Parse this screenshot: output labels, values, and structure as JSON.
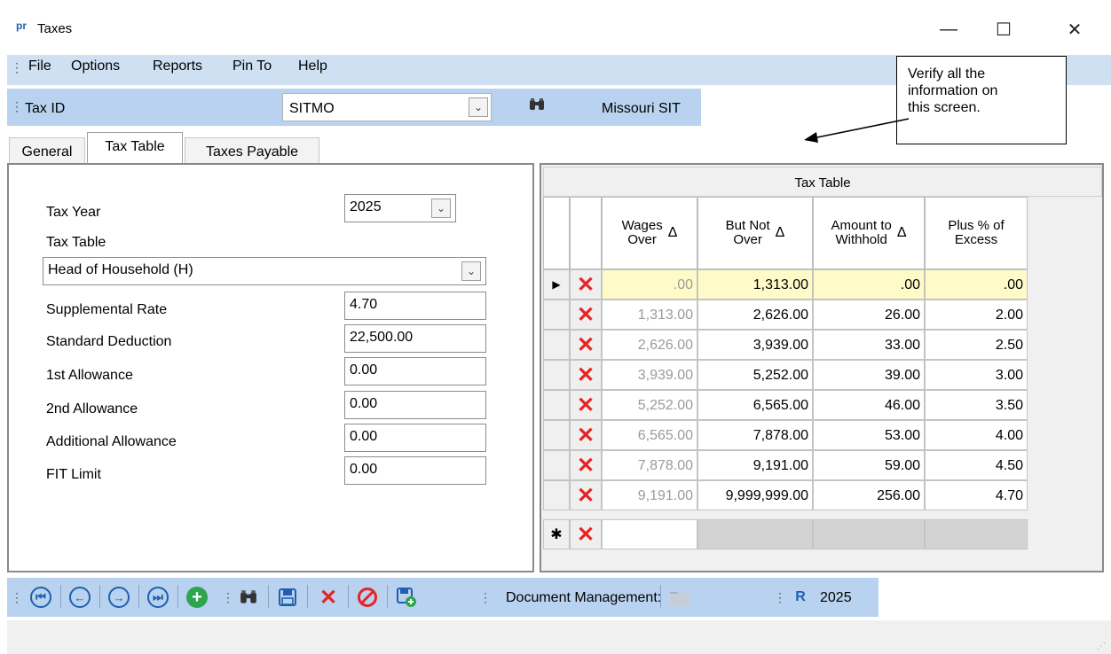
{
  "window": {
    "logo": "pr",
    "title": "Taxes",
    "minimize": "—",
    "maximize": "☐",
    "close": "✕"
  },
  "menu": [
    "File",
    "Options",
    "Reports",
    "Pin To",
    "Help"
  ],
  "taxbar": {
    "label": "Tax ID",
    "value": "SITMO",
    "name": "Missouri SIT"
  },
  "tabs": [
    "General",
    "Tax Table",
    "Taxes Payable"
  ],
  "form": {
    "tax_year_label": "Tax Year",
    "tax_year": "2025",
    "tax_table_label": "Tax Table",
    "tax_table": "Head of Household (H)",
    "fields": [
      {
        "label": "Supplemental Rate",
        "value": "4.70"
      },
      {
        "label": "Standard Deduction",
        "value": "22,500.00"
      },
      {
        "label": "1st Allowance",
        "value": "0.00"
      },
      {
        "label": "2nd Allowance",
        "value": "0.00"
      },
      {
        "label": "Additional Allowance",
        "value": "0.00"
      },
      {
        "label": "FIT Limit",
        "value": "0.00"
      }
    ]
  },
  "grid": {
    "title": "Tax Table",
    "columns": [
      {
        "line1": "Wages",
        "line2": "Over",
        "sort": "Δ"
      },
      {
        "line1": "But Not",
        "line2": "Over",
        "sort": "Δ"
      },
      {
        "line1": "Amount to",
        "line2": "Withhold",
        "sort": "Δ"
      },
      {
        "line1": "Plus % of",
        "line2": "Excess",
        "sort": ""
      }
    ],
    "rows": [
      [
        ".00",
        "1,313.00",
        ".00",
        ".00"
      ],
      [
        "1,313.00",
        "2,626.00",
        "26.00",
        "2.00"
      ],
      [
        "2,626.00",
        "3,939.00",
        "33.00",
        "2.50"
      ],
      [
        "3,939.00",
        "5,252.00",
        "39.00",
        "3.00"
      ],
      [
        "5,252.00",
        "6,565.00",
        "46.00",
        "3.50"
      ],
      [
        "6,565.00",
        "7,878.00",
        "53.00",
        "4.00"
      ],
      [
        "7,878.00",
        "9,191.00",
        "59.00",
        "4.50"
      ],
      [
        "9,191.00",
        "9,999,999.00",
        "256.00",
        "4.70"
      ]
    ],
    "current_row_marker": "▶",
    "new_row_marker": "✱"
  },
  "callout": {
    "line1": "Verify all the",
    "line2": "information on",
    "line3": "this screen."
  },
  "toolbar": {
    "doc_label": "Document Management:",
    "year": "2025"
  },
  "colors": {
    "toolbar": "#b8d2ef",
    "menubar": "#cfe0f3",
    "delete": "#e52424",
    "current_row": "#fffbc8",
    "accent": "#1f5fb0"
  }
}
